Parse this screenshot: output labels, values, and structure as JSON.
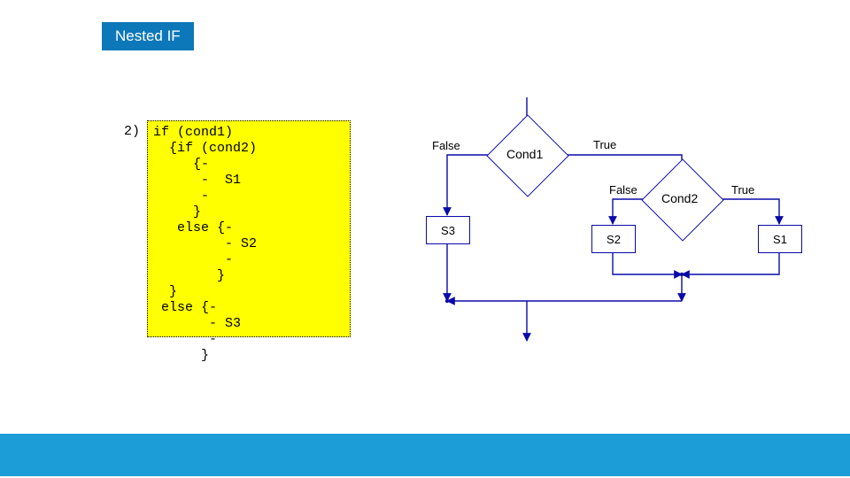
{
  "title": "Nested IF",
  "item_number": "2)",
  "code": "if (cond1)\n  {if (cond2)\n     {-\n      -  S1\n      -\n     }\n   else {-\n         - S2\n         -\n        }\n  }\n else {-\n       - S3\n       -\n      }",
  "flow": {
    "cond1": {
      "label": "Cond1",
      "false_label": "False",
      "true_label": "True"
    },
    "cond2": {
      "label": "Cond2",
      "false_label": "False",
      "true_label": "True"
    },
    "s1": "S1",
    "s2": "S2",
    "s3": "S3"
  },
  "chart_data": {
    "type": "diagram",
    "kind": "flowchart",
    "nodes": [
      {
        "id": "start",
        "type": "start"
      },
      {
        "id": "cond1",
        "type": "decision",
        "label": "Cond1"
      },
      {
        "id": "cond2",
        "type": "decision",
        "label": "Cond2"
      },
      {
        "id": "S1",
        "type": "process",
        "label": "S1"
      },
      {
        "id": "S2",
        "type": "process",
        "label": "S2"
      },
      {
        "id": "S3",
        "type": "process",
        "label": "S3"
      },
      {
        "id": "merge",
        "type": "merge"
      }
    ],
    "edges": [
      {
        "from": "start",
        "to": "cond1"
      },
      {
        "from": "cond1",
        "to": "S3",
        "label": "False"
      },
      {
        "from": "cond1",
        "to": "cond2",
        "label": "True"
      },
      {
        "from": "cond2",
        "to": "S2",
        "label": "False"
      },
      {
        "from": "cond2",
        "to": "S1",
        "label": "True"
      },
      {
        "from": "S1",
        "to": "merge"
      },
      {
        "from": "S2",
        "to": "merge"
      },
      {
        "from": "S3",
        "to": "merge"
      }
    ]
  }
}
